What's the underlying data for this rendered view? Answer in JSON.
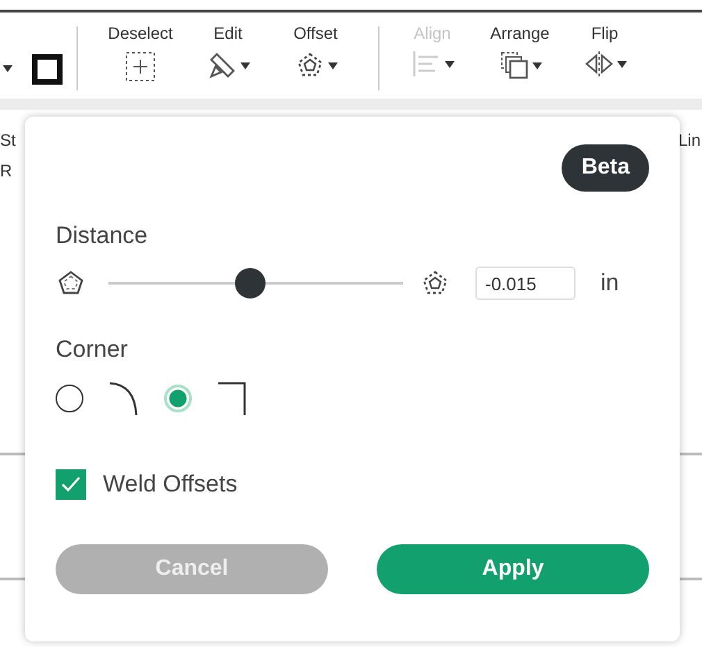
{
  "toolbar": {
    "items": [
      {
        "kind": "deselect",
        "label": "Deselect",
        "disabled": false,
        "caret": false
      },
      {
        "kind": "edit",
        "label": "Edit",
        "disabled": false,
        "caret": true
      },
      {
        "kind": "offset",
        "label": "Offset",
        "disabled": false,
        "caret": true
      },
      {
        "kind": "align",
        "label": "Align",
        "disabled": true,
        "caret": true
      },
      {
        "kind": "arrange",
        "label": "Arrange",
        "disabled": false,
        "caret": true
      },
      {
        "kind": "flip",
        "label": "Flip",
        "disabled": false,
        "caret": true
      }
    ]
  },
  "background": {
    "left_labels": [
      "St",
      "R"
    ],
    "right_labels": [
      "Lin"
    ]
  },
  "offset_panel": {
    "badge": "Beta",
    "distance": {
      "label": "Distance",
      "level": 0.48,
      "value": "-0.015",
      "unit": "in"
    },
    "corner": {
      "label": "Corner",
      "options": [
        {
          "kind": "round",
          "selected": false
        },
        {
          "kind": "square",
          "selected": true
        }
      ]
    },
    "weld": {
      "label": "Weld Offsets",
      "checked": true
    },
    "buttons": [
      {
        "kind": "secondary",
        "label": "Cancel"
      },
      {
        "kind": "primary",
        "label": "Apply"
      }
    ]
  }
}
